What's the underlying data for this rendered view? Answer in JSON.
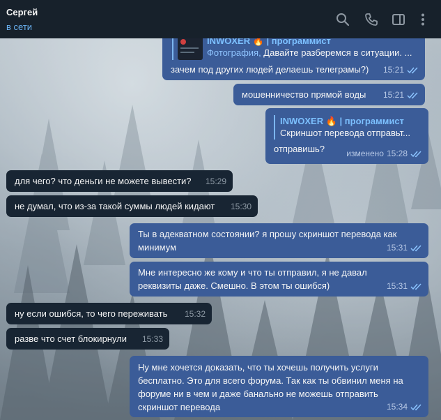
{
  "header": {
    "name": "Сергей",
    "status": "в сети"
  },
  "messages": [
    {
      "dir": "out",
      "reply_author": "INWOXER 🔥 | программист",
      "reply_kind": "Фотография,",
      "reply_text": " Давайте разберемся в ситуации. ...",
      "text": "зачем под других людей делаешь телеграмы?)",
      "time": "15:21"
    },
    {
      "dir": "out",
      "text": "мошенничество прямой воды",
      "time": "15:21"
    },
    {
      "dir": "out",
      "reply_author": "INWOXER 🔥 | программист",
      "reply_text": "Скриншот перевода отправьт...",
      "text": "отправишь?",
      "edited": "изменено",
      "time": "15:28"
    },
    {
      "dir": "in",
      "text": "для чего? что деньги не можете вывести?",
      "time": "15:29"
    },
    {
      "dir": "in",
      "text": "не думал, что из-за такой суммы людей кидают",
      "time": "15:30"
    },
    {
      "dir": "out",
      "text": "Ты в адекватном состоянии? я прошу скриншот перевода как минимум",
      "time": "15:31"
    },
    {
      "dir": "out",
      "text": "Мне интересно же кому и что ты отправил, я не давал реквизиты даже. Смешно. В этом ты ошибся)",
      "time": "15:31"
    },
    {
      "dir": "in",
      "text": "ну если ошибся, то чего переживать",
      "time": "15:32"
    },
    {
      "dir": "in",
      "text": "разве что счет блокирнули",
      "time": "15:33"
    },
    {
      "dir": "out",
      "text": "Ну мне хочется доказать, что ты хочешь получить услуги бесплатно. Это для всего форума. Так как ты обвинил меня на форуме ни в чем и даже банально не можешь отправить скриншот перевода",
      "time": "15:34"
    }
  ],
  "colors": {
    "header_bg": "#17212b",
    "outgoing_bubble": "#3b5c98",
    "incoming_bubble": "#182533",
    "accent": "#6ab2f2"
  },
  "icons": [
    "search-icon",
    "phone-icon",
    "sidebar-toggle-icon",
    "more-vertical-icon",
    "double-check-icon"
  ]
}
